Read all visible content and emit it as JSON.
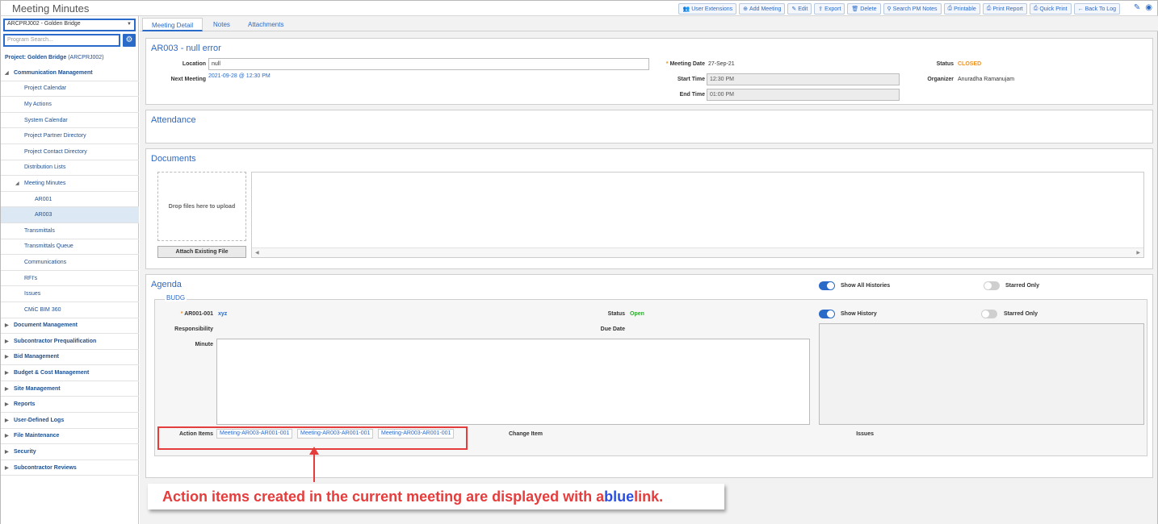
{
  "app": {
    "title": "Meeting Minutes"
  },
  "toolbar": [
    {
      "label": "User Extensions",
      "icon": "👥"
    },
    {
      "label": "Add Meeting",
      "icon": "⊕"
    },
    {
      "label": "Edit",
      "icon": "✎"
    },
    {
      "label": "Export",
      "icon": "⇪"
    },
    {
      "label": "Delete",
      "icon": "🗑"
    },
    {
      "label": "Search PM Notes",
      "icon": "⚲"
    },
    {
      "label": "Printable",
      "icon": "⎙"
    },
    {
      "label": "Print Report",
      "icon": "⎙"
    },
    {
      "label": "Quick Print",
      "icon": "⎙"
    },
    {
      "label": "Back To Log",
      "icon": "←"
    }
  ],
  "sidebar": {
    "project_select": "ARCPRJ002 - Golden Bridge",
    "search_placeholder": "Program Search...",
    "project_label": "Project: Golden Bridge",
    "project_code": "(ARCPRJ002)",
    "items": [
      {
        "label": "Communication Management",
        "level": "top",
        "expanded": true
      },
      {
        "label": "Project Calendar",
        "level": "sub"
      },
      {
        "label": "My Actions",
        "level": "sub"
      },
      {
        "label": "System Calendar",
        "level": "sub"
      },
      {
        "label": "Project Partner Directory",
        "level": "sub"
      },
      {
        "label": "Project Contact Directory",
        "level": "sub"
      },
      {
        "label": "Distribution Lists",
        "level": "sub"
      },
      {
        "label": "Meeting Minutes",
        "level": "sub",
        "expanded": true
      },
      {
        "label": "AR001",
        "level": "sub2"
      },
      {
        "label": "AR003",
        "level": "sub2",
        "active": true
      },
      {
        "label": "Transmittals",
        "level": "sub"
      },
      {
        "label": "Transmittals Queue",
        "level": "sub"
      },
      {
        "label": "Communications",
        "level": "sub"
      },
      {
        "label": "RFI's",
        "level": "sub"
      },
      {
        "label": "Issues",
        "level": "sub"
      },
      {
        "label": "CMiC BIM 360",
        "level": "sub"
      },
      {
        "label": "Document Management",
        "level": "top"
      },
      {
        "label": "Subcontractor Prequalification",
        "level": "top"
      },
      {
        "label": "Bid Management",
        "level": "top"
      },
      {
        "label": "Budget & Cost Management",
        "level": "top"
      },
      {
        "label": "Site Management",
        "level": "top"
      },
      {
        "label": "Reports",
        "level": "top"
      },
      {
        "label": "User-Defined Logs",
        "level": "top"
      },
      {
        "label": "File Maintenance",
        "level": "top"
      },
      {
        "label": "Security",
        "level": "top"
      },
      {
        "label": "Subcontractor Reviews",
        "level": "top"
      }
    ]
  },
  "tabs": [
    "Meeting Detail",
    "Notes",
    "Attachments"
  ],
  "detail": {
    "title": "AR003 - null error",
    "location_label": "Location",
    "location_value": "null",
    "next_meeting_label": "Next Meeting",
    "next_meeting_value": "2021-09-28 @ 12:30 PM",
    "meeting_date_label": "Meeting Date",
    "meeting_date_value": "27-Sep-21",
    "start_time_label": "Start Time",
    "start_time_value": "12:30 PM",
    "end_time_label": "End Time",
    "end_time_value": "01:00 PM",
    "status_label": "Status",
    "status_value": "CLOSED",
    "organizer_label": "Organizer",
    "organizer_value": "Anuradha Ramanujam"
  },
  "attendance": {
    "title": "Attendance"
  },
  "documents": {
    "title": "Documents",
    "drop_text": "Drop files here to upload",
    "attach_button": "Attach Existing File"
  },
  "agenda": {
    "title": "Agenda",
    "show_all_histories": "Show All Histories",
    "starred_only": "Starred Only",
    "group": "BUDG",
    "item_code": "AR001-001",
    "item_link": "xyz",
    "status_label": "Status",
    "status_value": "Open",
    "show_history": "Show History",
    "starred_only_2": "Starred Only",
    "responsibility_label": "Responsibility",
    "due_date_label": "Due Date",
    "minute_label": "Minute",
    "action_items_label": "Action Items",
    "action_items": [
      "Meeting-AR003-AR001-001",
      "Meeting-AR003-AR001-001",
      "Meeting-AR003-AR001-001"
    ],
    "change_item_label": "Change Item",
    "issues_label": "Issues"
  },
  "callout": {
    "text_before": "Action items created in the current meeting are displayed with a ",
    "text_blue": "blue",
    "text_after": " link."
  },
  "colors": {
    "accent": "#2a6ac8",
    "closed": "#f0901b",
    "open": "#3aa53a",
    "callout": "#e53c3c"
  }
}
